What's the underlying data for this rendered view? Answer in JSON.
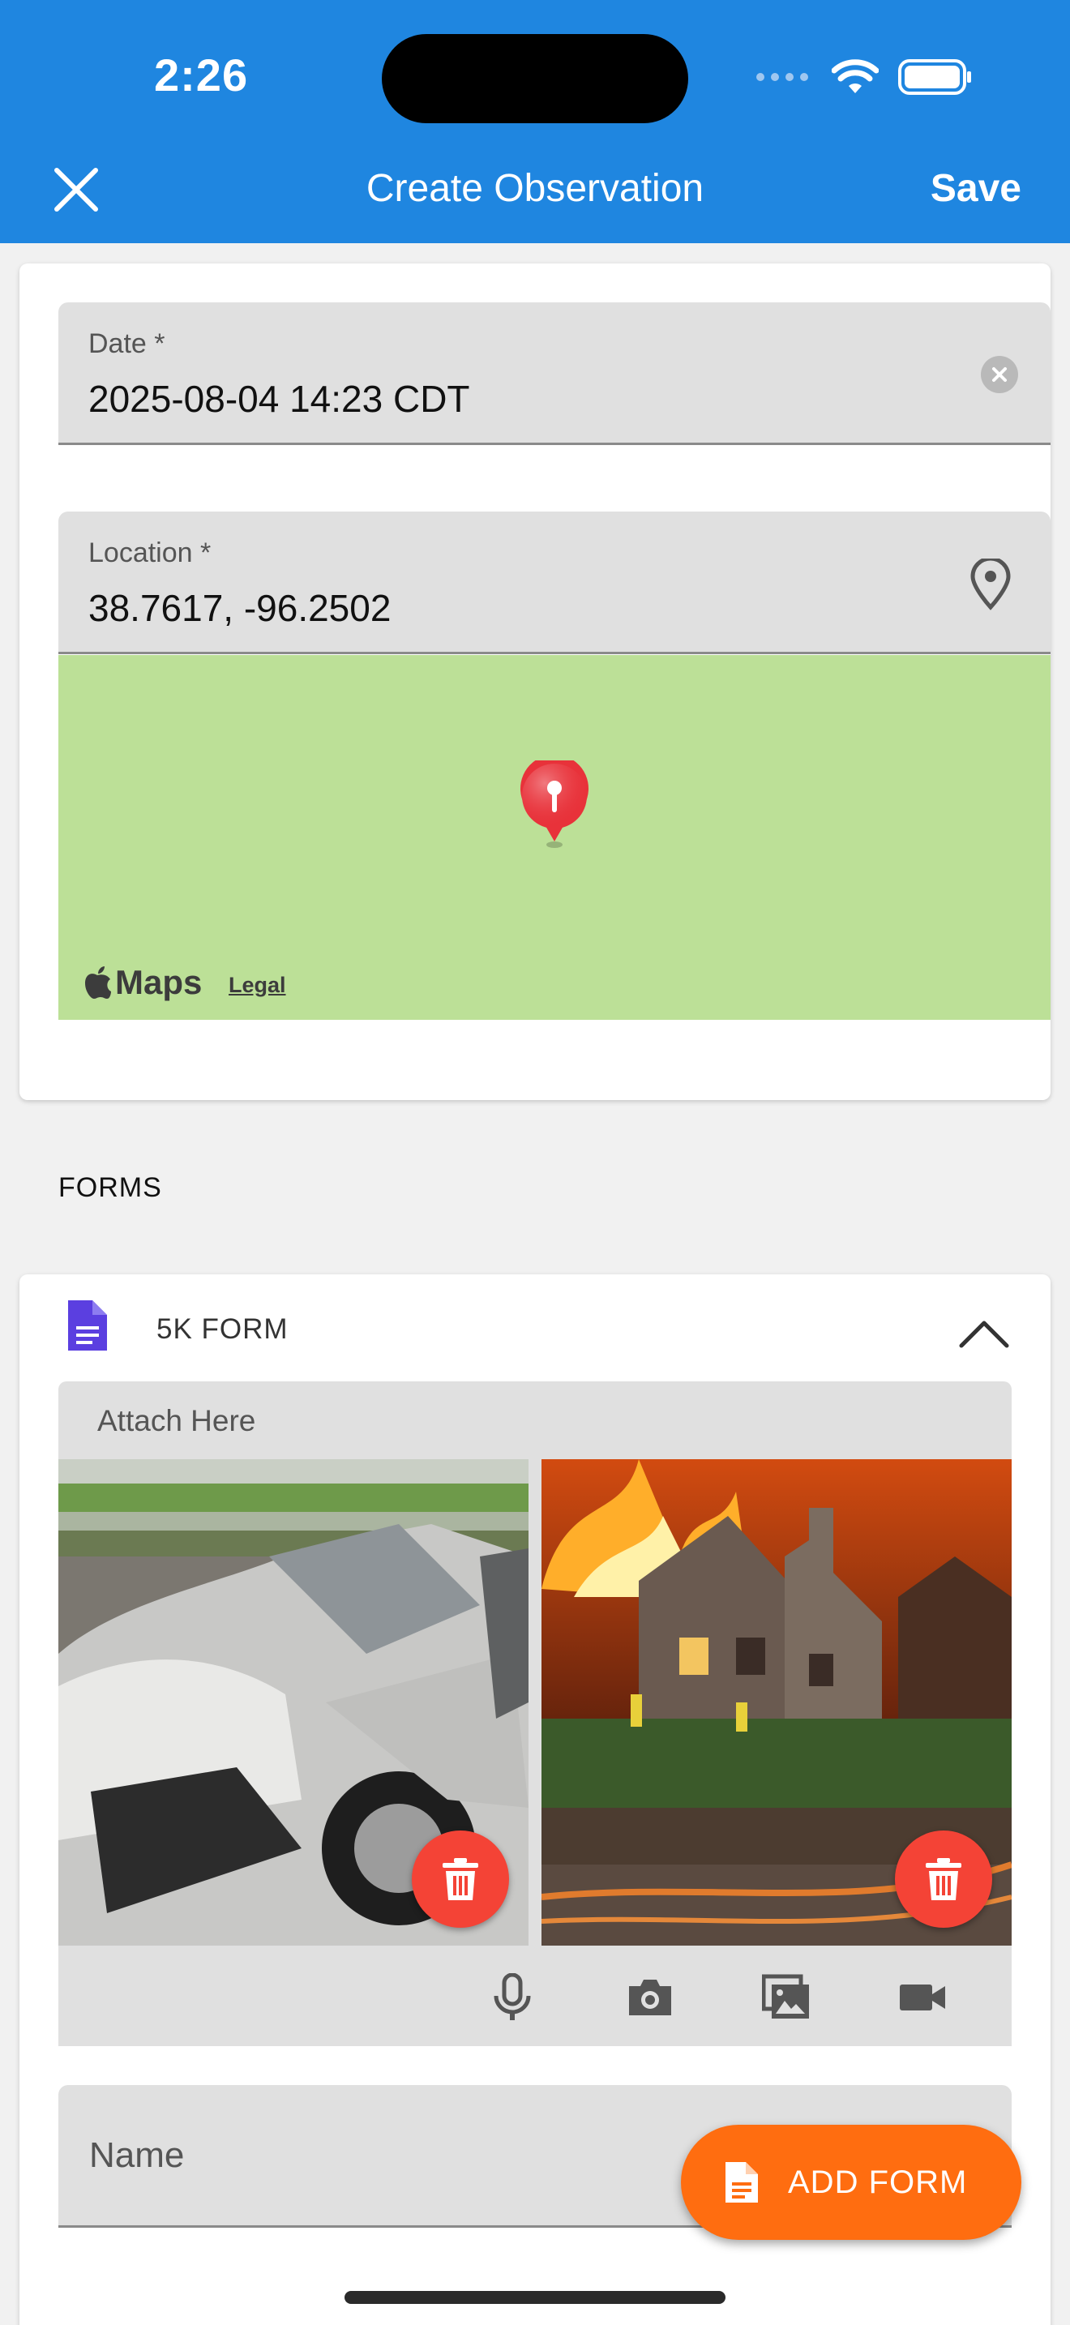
{
  "status_bar": {
    "time": "2:26"
  },
  "header": {
    "title": "Create Observation",
    "save_label": "Save"
  },
  "date_field": {
    "label": "Date *",
    "value": "2025-08-04 14:23 CDT"
  },
  "location_field": {
    "label": "Location *",
    "value": "38.7617, -96.2502"
  },
  "map": {
    "brand": "Maps",
    "legal_label": "Legal"
  },
  "forms_section": {
    "heading": "FORMS"
  },
  "form_card": {
    "title": "5K FORM",
    "attach_label": "Attach Here",
    "attachments": [
      {
        "name": "car-crash-photo"
      },
      {
        "name": "house-fire-photo"
      }
    ],
    "media_actions": [
      "microphone-icon",
      "camera-icon",
      "gallery-icon",
      "video-icon"
    ],
    "name_placeholder": "Name"
  },
  "fab": {
    "label": "ADD FORM"
  },
  "colors": {
    "header": "#1f86e0",
    "map": "#bce097",
    "delete": "#f44336",
    "fab": "#ff6d10",
    "form_icon": "#5b3fe0"
  }
}
